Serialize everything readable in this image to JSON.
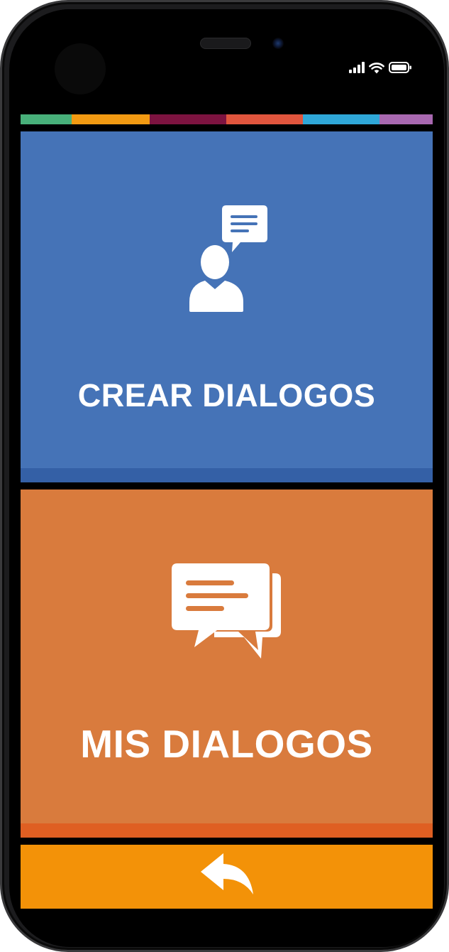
{
  "status_bar": {
    "icons": [
      "signal-icon",
      "wifi-icon",
      "battery-icon"
    ]
  },
  "color_strip": [
    "#48b07a",
    "#f29a12",
    "#7d1340",
    "#e0553d",
    "#2fa7d8",
    "#a868b0"
  ],
  "panels": {
    "create": {
      "label": "CREAR DIALOGOS",
      "icon": "person-speech-bubble-icon",
      "color": "#4573b7"
    },
    "mine": {
      "label": "MIS DIALOGOS",
      "icon": "chat-bubbles-icon",
      "color": "#d97b3d"
    }
  },
  "back_bar": {
    "icon": "back-arrow-icon",
    "color": "#f39208"
  }
}
